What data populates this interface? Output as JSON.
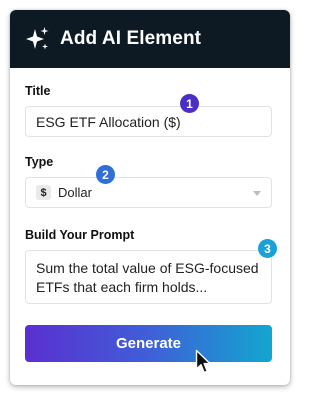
{
  "header": {
    "icon": "sparkle-icon",
    "title": "Add AI Element"
  },
  "title_section": {
    "label": "Title",
    "value": "ESG ETF Allocation ($)",
    "step": "1"
  },
  "type_section": {
    "label": "Type",
    "symbol": "$",
    "value": "Dollar",
    "step": "2"
  },
  "prompt_section": {
    "label": "Build Your Prompt",
    "value": "Sum the total value of ESG-focused ETFs that each firm holds...",
    "step": "3"
  },
  "generate_button": {
    "label": "Generate"
  },
  "colors": {
    "header_bg": "#0d1a24",
    "gradient_start": "#5b2fd0",
    "gradient_end": "#13a6cf",
    "badge_1": "#4b2fc4",
    "badge_2": "#2f6fd6",
    "badge_3": "#1aa1d6"
  }
}
